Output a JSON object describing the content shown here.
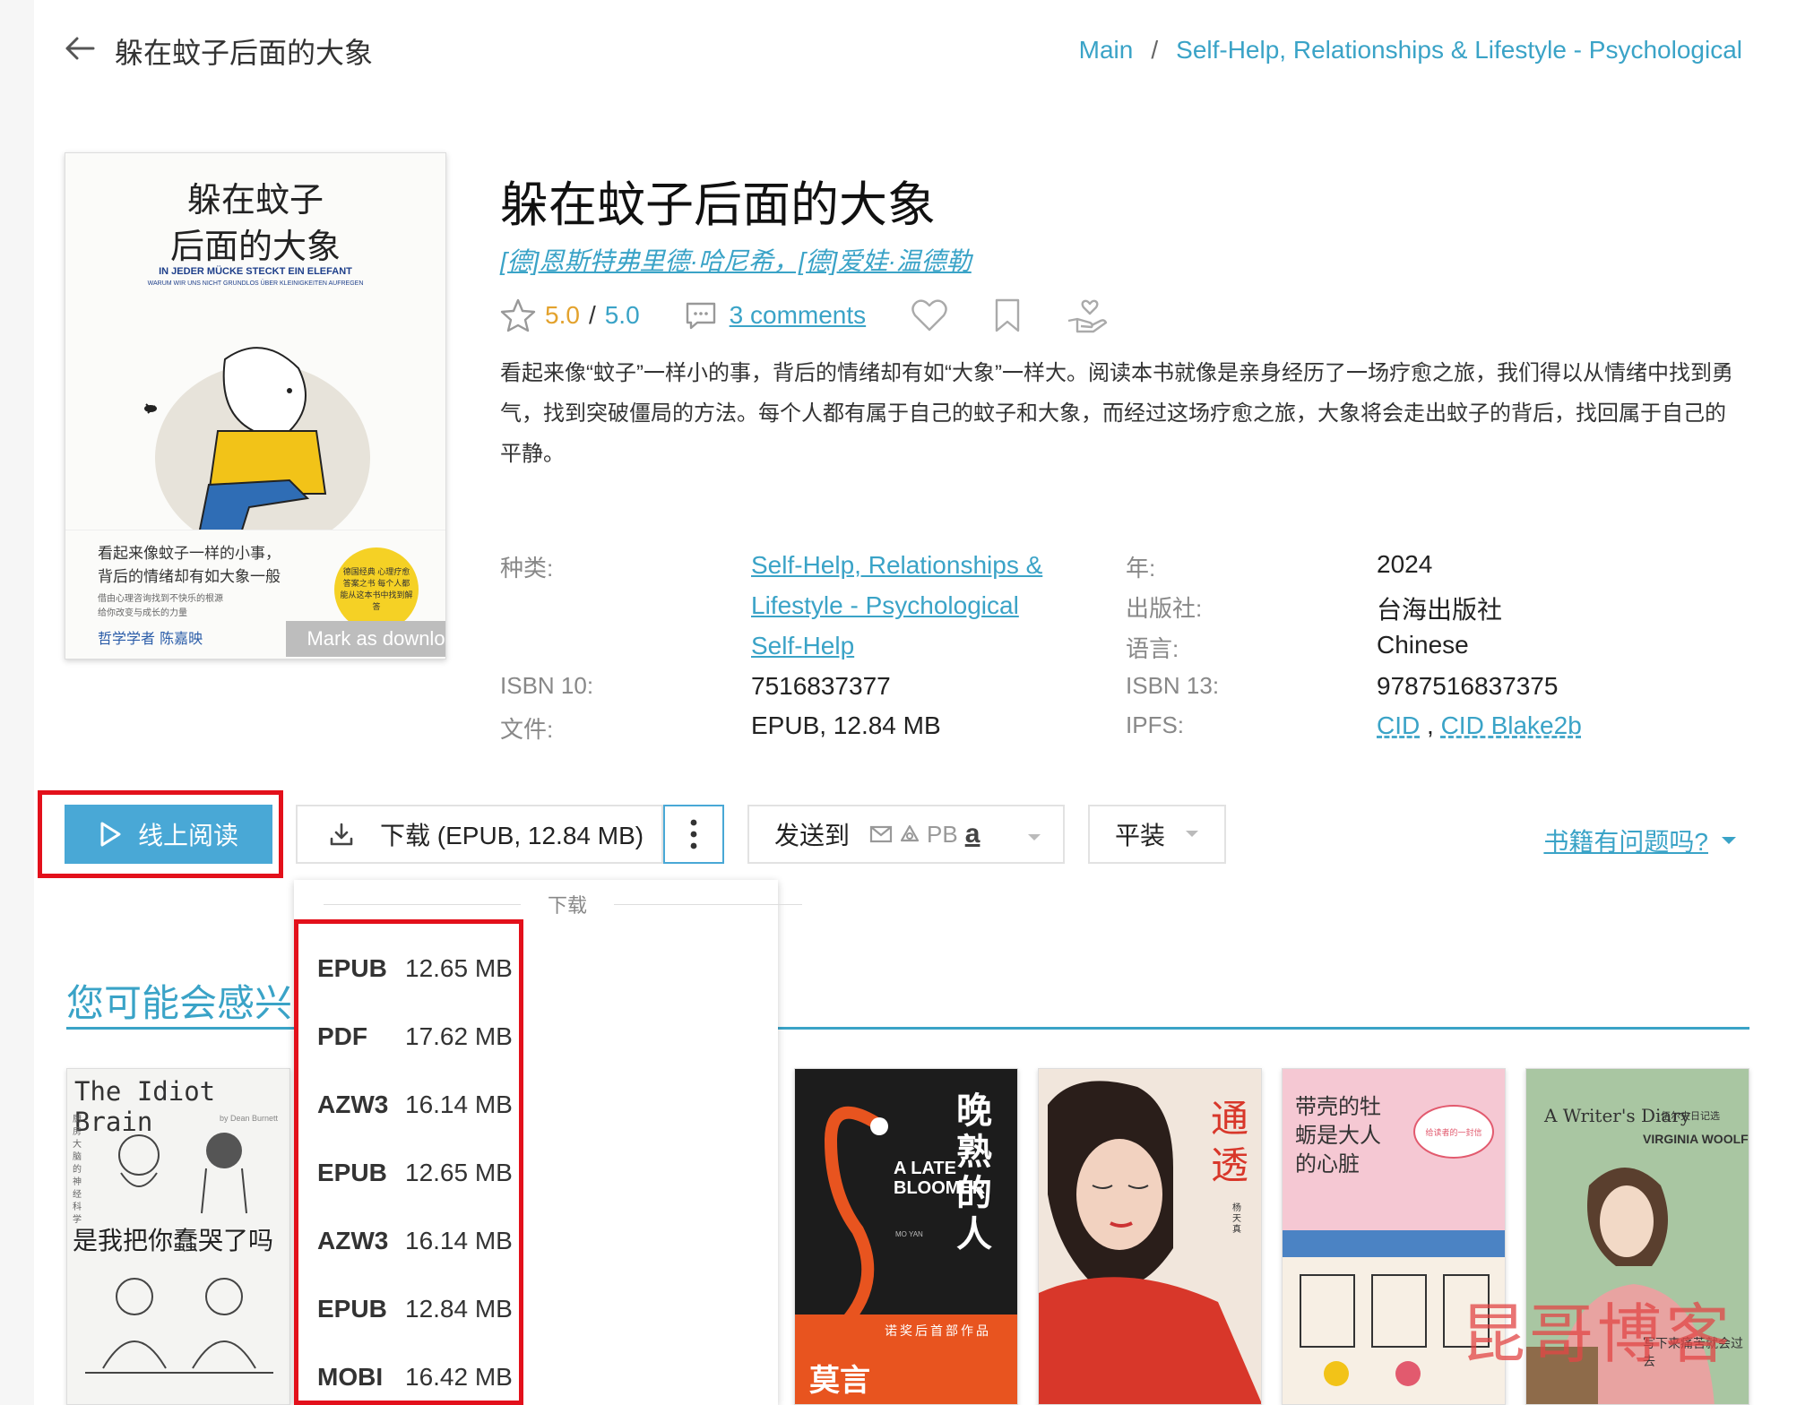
{
  "header": {
    "title": "躲在蚊子后面的大象",
    "breadcrumb": [
      "Main",
      "Self-Help, Relationships & Lifestyle - Psychological"
    ]
  },
  "cover": {
    "title_line1": "躲在蚊子",
    "title_line2": "后面的大象",
    "subtitle": "IN JEDER MÜCKE STECKT EIN ELEFANT",
    "subtitle2": "WARUM WIR UNS NICHT GRUNDLOS ÜBER KLEINIGKEITEN AUFREGEN",
    "tagline_1": "看起来像蚊子一样的小事，",
    "tagline_2": "背后的情绪却有如大象一般",
    "tagline_small_1": "借由心理咨询找到不快乐的根源",
    "tagline_small_2": "给你改变与成长的力量",
    "badge": "德国经典 心理疗愈答案之书 每个人都能从这本书中找到解答",
    "author_line": "哲学学者 陈嘉映",
    "mark_downloaded": "Mark as downloaded"
  },
  "book": {
    "title": "躲在蚊子后面的大象",
    "authors": "[德]恩斯特弗里德·哈尼希，[德]爱娃·温德勒",
    "rating_current": "5.0",
    "rating_sep": "/",
    "rating_max": "5.0",
    "comments": "3 comments",
    "description": "看起来像“蚊子”一样小的事，背后的情绪却有如“大象”一样大。阅读本书就像是亲身经历了一场疗愈之旅，我们得以从情绪中找到勇气，找到突破僵局的方法。每个人都有属于自己的蚊子和大象，而经过这场疗愈之旅，大象将会走出蚊子的背后，找回属于自己的平静。"
  },
  "properties": {
    "category_label": "种类:",
    "category_link1": "Self-Help, Relationships &",
    "category_link2": "Lifestyle - Psychological",
    "category_link3": "Self-Help",
    "year_label": "年:",
    "year": "2024",
    "publisher_label": "出版社:",
    "publisher": "台海出版社",
    "language_label": "语言:",
    "language": "Chinese",
    "isbn10_label": "ISBN 10:",
    "isbn10": "7516837377",
    "isbn13_label": "ISBN 13:",
    "isbn13": "9787516837375",
    "file_label": "文件:",
    "file": "EPUB, 12.84 MB",
    "ipfs_label": "IPFS:",
    "ipfs_cid": "CID",
    "ipfs_sep": ",",
    "ipfs_blake": "CID Blake2b"
  },
  "actions": {
    "read_online": "线上阅读",
    "download": "下载 (EPUB, 12.84 MB)",
    "send_to": "发送到",
    "send_pb": "PB",
    "send_amazon": "a",
    "format": "平装",
    "report_issue": "书籍有问题吗?"
  },
  "dropdown": {
    "header": "下载",
    "items": [
      {
        "format": "EPUB",
        "size": "12.65 MB"
      },
      {
        "format": "PDF",
        "size": "17.62 MB"
      },
      {
        "format": "AZW3",
        "size": "16.14 MB"
      },
      {
        "format": "EPUB",
        "size": "12.65 MB"
      },
      {
        "format": "AZW3",
        "size": "16.14 MB"
      },
      {
        "format": "EPUB",
        "size": "12.84 MB"
      },
      {
        "format": "MOBI",
        "size": "16.42 MB"
      }
    ]
  },
  "recommendations": {
    "title": "您可能会感兴",
    "books": [
      {
        "title": "The Idiot Brain",
        "subtitle": "是我把你蠢哭了吗",
        "author": "by Dean Burnett",
        "side": "厨房大脑的神经科学"
      },
      {
        "title": "晚熟的人",
        "subtitle": "A LATE BLOOMER",
        "author": "莫言",
        "author_en": "MO YAN",
        "tag": "诺奖后首部作品"
      },
      {
        "title": "通透",
        "author": "杨天真"
      },
      {
        "title": "带壳的牡蛎是大人的心脏",
        "tag": "给读者的一封信"
      },
      {
        "title": "A Writer's Diary",
        "subtitle": "VIRGINIA WOOLF",
        "cn": "伍尔夫日记选",
        "cn2": "写下来痛苦就会过去"
      }
    ]
  },
  "watermark": "昆哥博客",
  "colors": {
    "accent": "#3aa3c7",
    "button_blue": "#49a8d6",
    "highlight_red": "#e3101b",
    "rating_orange": "#e3a22d"
  }
}
